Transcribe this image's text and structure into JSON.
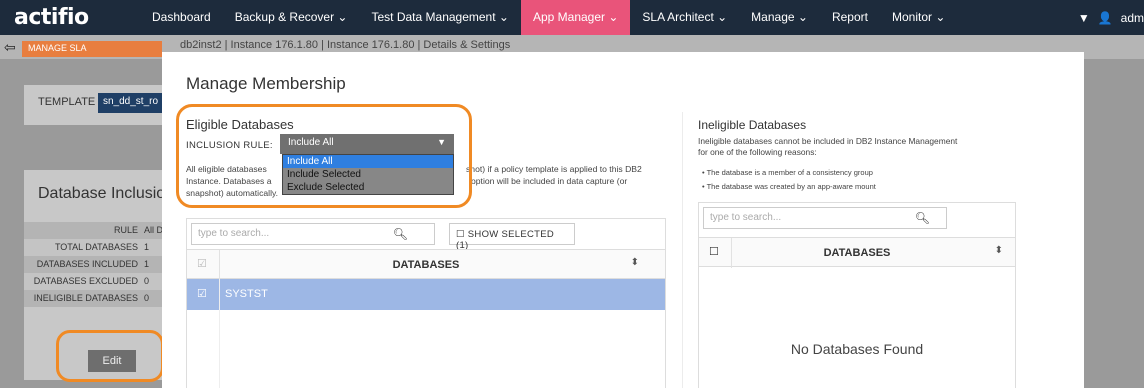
{
  "nav": {
    "logo": "actifio",
    "items": [
      "Dashboard",
      "Backup & Recover ⌄",
      "Test Data Management ⌄",
      "App Manager ⌄",
      "SLA Architect ⌄",
      "Manage ⌄",
      "Report",
      "Monitor ⌄"
    ],
    "active_index": 3,
    "user": "adm"
  },
  "subbar": {
    "back_label": "MANAGE SLA",
    "info": "db2inst2   |  Instance 176.1.80   |  Instance 176.1.80   |  Details & Settings"
  },
  "background": {
    "template_label": "TEMPLATE",
    "template_value": "sn_dd_st_ro",
    "inclusion_title": "Database Inclusion",
    "stats": [
      {
        "k": "RULE",
        "v": "All D"
      },
      {
        "k": "TOTAL DATABASES",
        "v": "1"
      },
      {
        "k": "DATABASES INCLUDED",
        "v": "1"
      },
      {
        "k": "DATABASES EXCLUDED",
        "v": "0"
      },
      {
        "k": "INELIGIBLE DATABASES",
        "v": "0"
      }
    ],
    "edit_label": "Edit"
  },
  "modal": {
    "title": "Manage Membership",
    "eligible": {
      "title": "Eligible Databases",
      "rule_label": "INCLUSION RULE:",
      "rule_value": "Include All",
      "options": [
        "Include All",
        "Include Selected",
        "Exclude Selected"
      ],
      "selected_option": 0,
      "desc_l1a": "All eligible databases",
      "desc_l1b": "shot) if a policy template is applied to this DB2",
      "desc_l2a": "Instance. Databases a",
      "desc_l2b": "option will be included in data capture (or",
      "desc_l3": "snapshot) automatically.",
      "search_placeholder": "type to search...",
      "show_selected": "SHOW SELECTED (1)",
      "col_header": "DATABASES",
      "rows": [
        "SYSTST"
      ]
    },
    "ineligible": {
      "title": "Ineligible Databases",
      "desc": "Ineligible databases cannot be included in DB2 Instance Management for one of the following reasons:",
      "bullet1": "•  The database is a member of a consistency group",
      "bullet2": "•  The database was created by an app-aware mount",
      "search_placeholder": "type to search...",
      "col_header": "DATABASES",
      "empty": "No Databases Found"
    }
  }
}
